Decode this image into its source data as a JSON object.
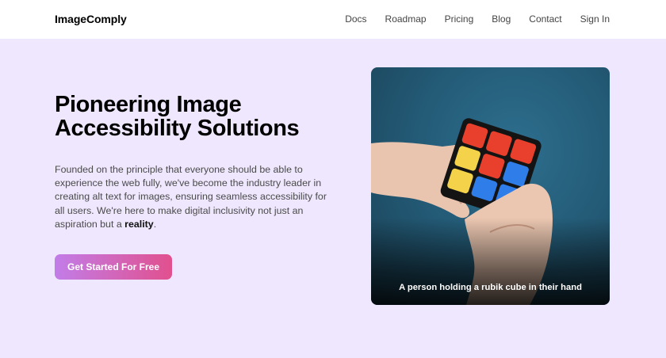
{
  "header": {
    "logo": "ImageComply",
    "nav": [
      {
        "label": "Docs"
      },
      {
        "label": "Roadmap"
      },
      {
        "label": "Pricing"
      },
      {
        "label": "Blog"
      },
      {
        "label": "Contact"
      },
      {
        "label": "Sign In"
      }
    ]
  },
  "hero": {
    "title_line1": "Pioneering Image",
    "title_line2": "Accessibility Solutions",
    "description": "Founded on the principle that everyone should be able to experience the web fully, we've become the industry leader in creating alt text for images, ensuring seamless accessibility for all users. We're here to make digital inclusivity not just an aspiration but a ",
    "description_emphasis": "reality",
    "description_end": ".",
    "cta_label": "Get Started For Free",
    "image_caption": "A person holding a rubik cube in their hand"
  },
  "colors": {
    "page_background": "#efe7fd",
    "cta_gradient_start": "#c27de8",
    "cta_gradient_end": "#e1508e"
  }
}
